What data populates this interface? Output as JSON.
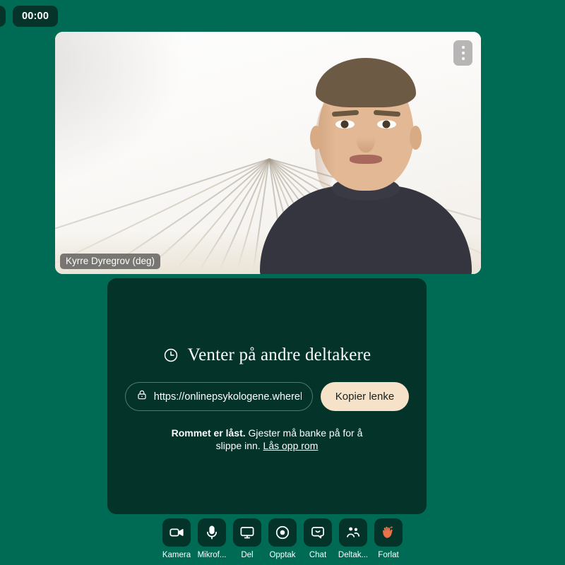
{
  "theme": {
    "background": "#006b55",
    "panel": "#04332a",
    "accent_button": "#f6e2c8",
    "text": "#ffffff",
    "leave_hand": "#e8734a"
  },
  "topbar": {
    "timer": "00:00"
  },
  "video": {
    "participant_name": "Kyrre Dyregrov (deg)",
    "menu_icon": "more-vertical-icon"
  },
  "waiting": {
    "title": "Venter på andre deltakere",
    "clock_icon": "clock-icon",
    "url": "https://onlinepsykologene.whereby.co",
    "url_lock_icon": "lock-icon",
    "copy_label": "Kopier lenke",
    "locked_bold": "Rommet er låst.",
    "locked_rest": " Gjester må banke på for å slippe inn. ",
    "unlock_label": "Lås opp rom"
  },
  "toolbar": {
    "items": [
      {
        "label": "Kamera",
        "icon": "camera-icon"
      },
      {
        "label": "Mikrof...",
        "icon": "microphone-icon"
      },
      {
        "label": "Del",
        "icon": "screen-share-icon"
      },
      {
        "label": "Opptak",
        "icon": "record-icon"
      },
      {
        "label": "Chat",
        "icon": "chat-icon"
      },
      {
        "label": "Deltak...",
        "icon": "participants-icon"
      },
      {
        "label": "Forlat",
        "icon": "waving-hand-icon"
      }
    ]
  }
}
